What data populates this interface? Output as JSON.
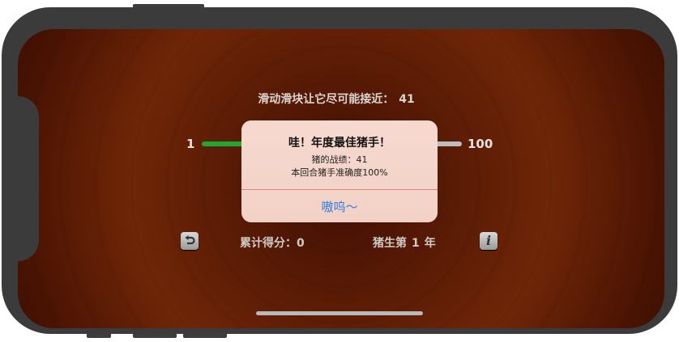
{
  "game": {
    "target_prompt": "滑动滑块让它尽可能接近：",
    "target_value": "41",
    "slider": {
      "min_label": "1",
      "max_label": "100",
      "value": 41,
      "min": 1,
      "max": 100
    },
    "score_label": "累计得分：",
    "score_value": "0",
    "round_prefix": "猪生第",
    "round_value": "1",
    "round_suffix": "年",
    "reset_icon": "undo-arrow-icon",
    "info_icon": "info-icon"
  },
  "alert": {
    "title": "哇！年度最佳猪手！",
    "message_line1": "猪的战绩：41",
    "message_line2": "本回合猪手准确度100%",
    "button_label": "嗷呜～"
  },
  "colors": {
    "background": "#642006",
    "slider_fill": "#1ea82c",
    "slider_track": "#bdbdbd",
    "alert_background": "#f6d9cf",
    "alert_button": "#2f7fe0"
  }
}
